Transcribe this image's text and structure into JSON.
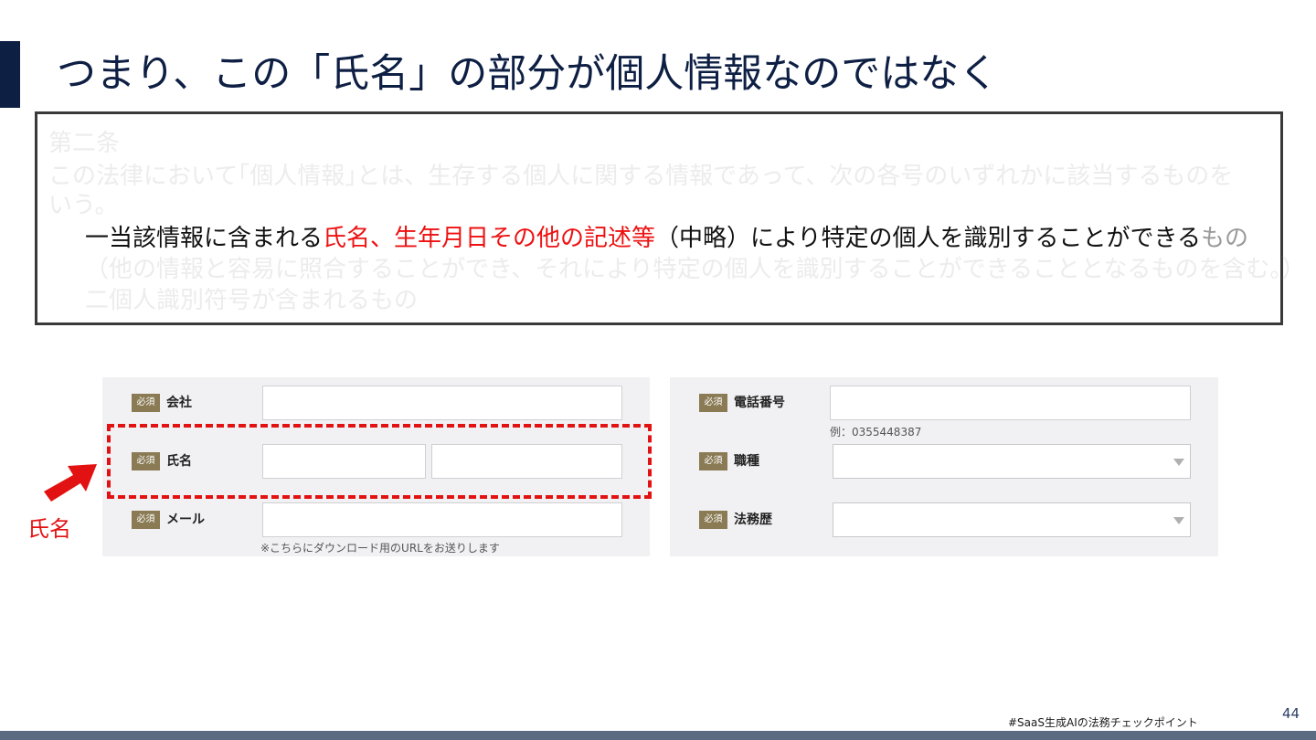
{
  "slide": {
    "title": "つまり、この「氏名」の部分が個人情報なのではなく",
    "page_number": "44",
    "footer_tag": "#SaaS生成AIの法務チェックポイント",
    "accent_color": "#0e1f44"
  },
  "law": {
    "article": "第二条",
    "intro_line1": "この法律において｢個人情報｣とは、生存する個人に関する情報であって、次の各号のいずれかに該当するものを",
    "intro_line2": "いう。",
    "item1_prefix": "一当該情報に含まれる",
    "item1_highlight": "氏名、生年月日その他の記述等",
    "item1_middle": "（中略）により特定の個人を識別することができる",
    "item1_tail": "もの",
    "item1_paren": "（他の情報と容易に照合することができ、それにより特定の個人を識別することができることとなるものを含む。）",
    "item2": "二個人識別符号が含まれるもの",
    "highlight_color": "#ee1111"
  },
  "form": {
    "required_badge": "必須",
    "left": {
      "company_label": "会社",
      "name_label": "氏名",
      "email_label": "メール",
      "email_hint": "※こちらにダウンロード用のURLをお送りします"
    },
    "right": {
      "phone_label": "電話番号",
      "phone_hint": "例：0355448387",
      "job_label": "職種",
      "legal_exp_label": "法務歴"
    },
    "badge_color": "#8a7b55"
  },
  "annotation": {
    "callout_label": "氏名",
    "color": "#e31212"
  }
}
